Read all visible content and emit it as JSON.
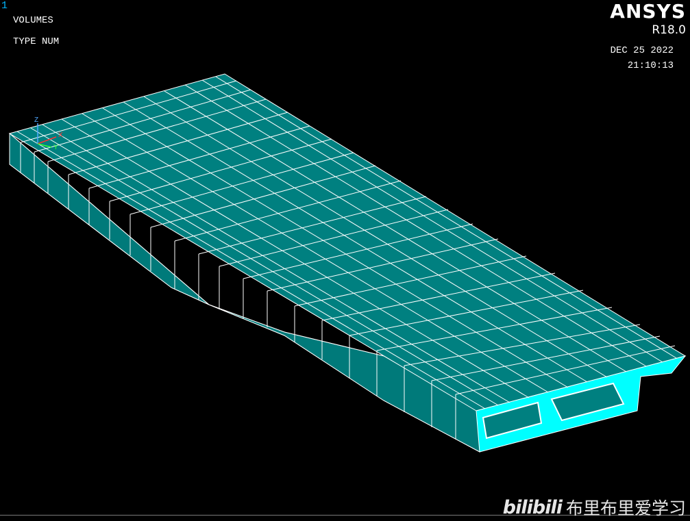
{
  "window": {
    "number": "1",
    "line1": "VOLUMES",
    "line2": "TYPE NUM"
  },
  "logo": {
    "brand": "ANSYS",
    "version": "R18.0"
  },
  "timestamp": {
    "date": "DEC 25 2022",
    "time": "21:10:13"
  },
  "triad": {
    "z_label": "Z",
    "x_label": "X",
    "y_label": "Y"
  },
  "watermark": {
    "logo_text": "bilibili",
    "caption": "布里布里爱学习"
  },
  "colors": {
    "background": "#000000",
    "volume_fill": "#008080",
    "volume_edge": "#ffffff",
    "end_face": "#00ffff",
    "triad_z": "#4fa8ff",
    "triad_x": "#ff3333",
    "triad_y": "#33ff33"
  }
}
